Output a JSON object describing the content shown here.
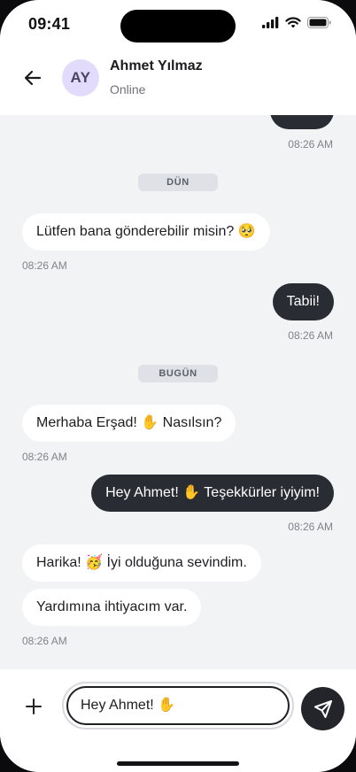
{
  "status_bar": {
    "time": "09:41"
  },
  "contact": {
    "initials": "AY",
    "name": "Ahmet Yılmaz",
    "status": "Online"
  },
  "dividers": {
    "yesterday": "DÜN",
    "today": "BUGÜN"
  },
  "messages": [
    {
      "from": "me",
      "text": "",
      "time": "08:26 AM"
    },
    {
      "from": "them",
      "text": "Lütfen bana gönderebilir misin? 🥺",
      "time": "08:26 AM"
    },
    {
      "from": "me",
      "text": "Tabii!",
      "time": "08:26 AM"
    },
    {
      "from": "them",
      "text": "Merhaba Erşad! ✋ Nasılsın?",
      "time": "08:26 AM"
    },
    {
      "from": "me",
      "text": "Hey Ahmet! ✋ Teşekkürler iyiyim!",
      "time": "08:26 AM"
    },
    {
      "from": "them",
      "text": "Harika! 🥳 İyi olduğuna sevindim.",
      "time": ""
    },
    {
      "from": "them",
      "text": "Yardımına ihtiyacım var.",
      "time": "08:26 AM"
    }
  ],
  "composer": {
    "value": "Hey Ahmet! ✋"
  },
  "icons": {
    "back": "arrow-left-icon",
    "signal": "signal-icon",
    "wifi": "wifi-icon",
    "battery": "battery-icon",
    "add": "plus-icon",
    "send": "send-icon"
  },
  "colors": {
    "outgoing_bubble": "#2a2c33",
    "incoming_bubble": "#ffffff",
    "chat_background": "#f2f3f5",
    "avatar_background": "#e3dbfb"
  }
}
